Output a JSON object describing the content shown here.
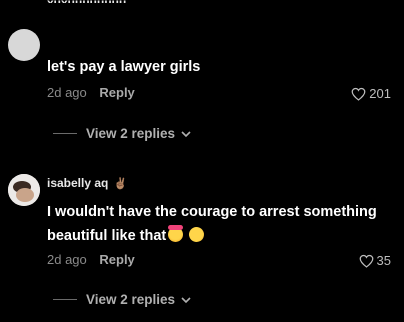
{
  "comments": [
    {
      "username": "xuxuuuuuuuu",
      "text": "let's pay a lawyer girls",
      "time": "2d ago",
      "reply_label": "Reply",
      "likes": "201",
      "view_replies": "View 2 replies"
    },
    {
      "username": "isabelly aq",
      "username_emoji": "✌🏽",
      "text": "I wouldn't have the courage to arrest something beautiful like that",
      "text_emojis": [
        "heart-eyes-emoji",
        "rofl-emoji"
      ],
      "time": "2d ago",
      "reply_label": "Reply",
      "likes": "35",
      "view_replies": "View 2 replies"
    }
  ],
  "colors": {
    "background": "#000000",
    "text_primary": "#ffffff",
    "text_secondary": "#8a8a8a"
  }
}
